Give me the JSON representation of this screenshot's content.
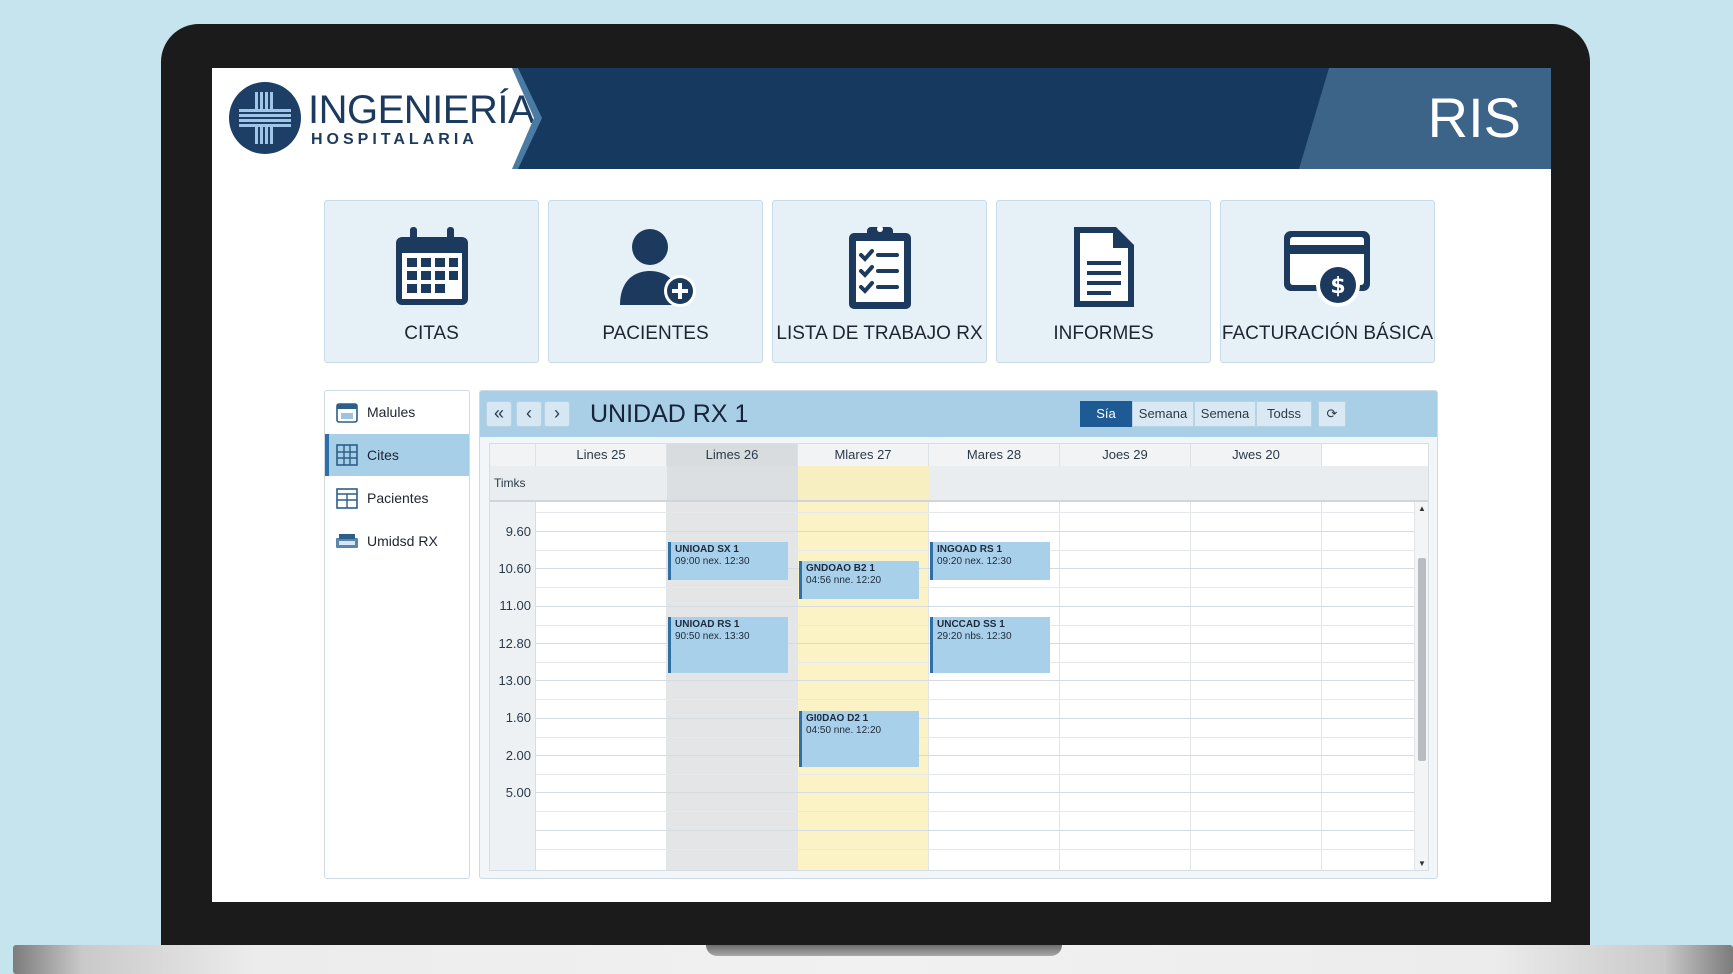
{
  "app": {
    "logo_title": "INGENIERÍA",
    "logo_subtitle": "HOSPITALARIA",
    "product": "RIS"
  },
  "modules": [
    {
      "label": "CITAS",
      "icon": "calendar-icon"
    },
    {
      "label": "PACIENTES",
      "icon": "add-patient-icon"
    },
    {
      "label": "LISTA DE TRABAJO RX",
      "icon": "clipboard-checklist-icon"
    },
    {
      "label": "INFORMES",
      "icon": "document-icon"
    },
    {
      "label": "FACTURACIÓN BÁSICA",
      "icon": "billing-card-icon"
    }
  ],
  "sidebar": {
    "items": [
      {
        "label": "Malules",
        "icon": "calendar-icon",
        "active": false
      },
      {
        "label": "Cites",
        "icon": "grid-icon",
        "active": true
      },
      {
        "label": "Pacientes",
        "icon": "calendar-grid-icon",
        "active": false
      },
      {
        "label": "Umidsd RX",
        "icon": "xray-machine-icon",
        "active": false
      }
    ]
  },
  "calendar": {
    "title": "UNIDAD RX 1",
    "nav": {
      "first": "«",
      "prev": "‹",
      "next": "›"
    },
    "views": [
      {
        "label": "Sía",
        "active": true
      },
      {
        "label": "Semana",
        "active": false
      },
      {
        "label": "Semena",
        "active": false
      },
      {
        "label": "Todss",
        "active": false
      }
    ],
    "refresh_icon": "refresh-icon",
    "time_header": "Timks",
    "days": [
      "Lines 25",
      "Limes 26",
      "Mlares 27",
      "Mares 28",
      "Joes 29",
      "Jwes 20"
    ],
    "times": [
      "9.60",
      "10.60",
      "11.00",
      "12.80",
      "13.00",
      "1.60",
      "2.00",
      "5.00"
    ],
    "events": [
      {
        "title": "UNIOAD SX 1",
        "time": "09:00 nex. 12:30"
      },
      {
        "title": "UNIOAD RS 1",
        "time": "90:50 nex. 13:30"
      },
      {
        "title": "GNDOAO B2 1",
        "time": "04:56 nne. 12:20"
      },
      {
        "title": "GI0DAO D2 1",
        "time": "04:50 nne. 12:20"
      },
      {
        "title": "INGOAD RS 1",
        "time": "09:20 nex. 12:30"
      },
      {
        "title": "UNCCAD SS 1",
        "time": "29:20 nbs. 12:30"
      }
    ],
    "colors": {
      "accent": "#1e5b94",
      "event": "#a8d0ea",
      "today": "#fbf2c6",
      "weekend_shade": "#e3e5e7"
    }
  }
}
